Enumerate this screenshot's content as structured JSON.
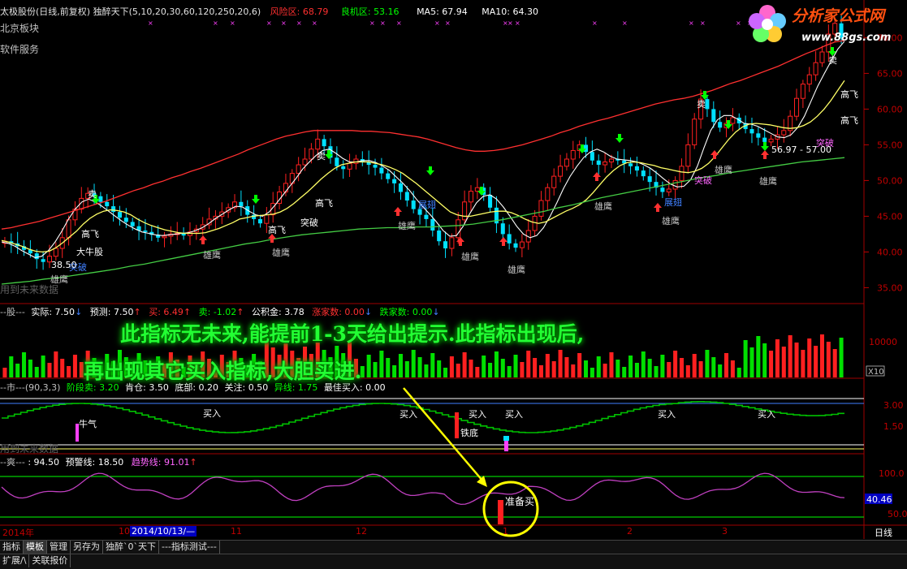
{
  "header": {
    "stock": "太极股份(日线,前复权)",
    "indicator": "独醉天下(5,10,20,30,60,120,250,20,6)",
    "risk_label": "风险区:",
    "risk_value": "68.79",
    "good_label": "良机区:",
    "good_value": "53.16",
    "ma5": "MA5: 67.94",
    "ma10": "MA10: 64.30",
    "line2": "北京板块",
    "line3": "软件服务",
    "nofuture": "用到未来数据",
    "colors": {
      "risk": "#ff3030",
      "good": "#00ff00",
      "text": "#e0e0e0",
      "ma5": "#ffffff",
      "ma10": "#ffffff"
    }
  },
  "logo": {
    "title": "分析家公式网",
    "url": "www.88gs.com"
  },
  "overlay": {
    "line1": "此指标无未来,能提前1-3天给出提示.此指标出现后,",
    "line2": "再出现其它买入指标,大胆买进."
  },
  "panel2": {
    "label": "--股---",
    "actual": "实际: 7.50",
    "predict": "预测: 7.50",
    "buy": "买: 6.49",
    "sell": "卖: -1.02",
    "fund": "公积金: 3.78",
    "up": "涨家数: 0.00",
    "down": "跌家数: 0.00",
    "x10": "X10"
  },
  "panel3": {
    "label": "--市---(90,3,3)",
    "stage_sell": "阶段卖: 3.20",
    "hold": "肯仓: 3.50",
    "bottom": "底部: 0.20",
    "focus": "关注: 0.50",
    "abnormal": "异线: 1.75",
    "best_buy": "最佳买入: 0.00",
    "nofuture": "用到未来数据"
  },
  "panel4": {
    "label": "--爽---",
    "v1": ": 94.50",
    "warn": "预警线: 18.50",
    "trend": "趋势线: 91.01",
    "current": "40.46",
    "annotation": "准备买"
  },
  "annotations": {
    "sell": "卖",
    "high_fly": "高飞",
    "break": "突破",
    "eagle": "雄鹰",
    "big_bull": "大牛股",
    "expand": "展翅",
    "buy": "买入",
    "bull": "牛气",
    "iron_bottom": "铁底",
    "low_price": "38.50",
    "range_label": "56.97 - 57.00",
    "buy_tiny": "买"
  },
  "xaxis": {
    "labels": [
      "2014年",
      "10",
      "11",
      "12",
      "1",
      "2",
      "3"
    ],
    "cursor": "2014/10/13/—",
    "right": "日线"
  },
  "tabs": [
    "指标",
    "模板",
    "管理",
    "另存为",
    "独醉`0`天下",
    "---指标测试---"
  ],
  "tabs2": [
    "扩展/\\",
    "关联报价"
  ],
  "chart_data": {
    "type": "line",
    "title": "太极股份(日线,前复权)",
    "price_axis": [
      70,
      65,
      60,
      55,
      50,
      45,
      40,
      35
    ],
    "ylim": [
      33,
      73
    ],
    "x_ticks": [
      "2014年",
      "10",
      "11",
      "12",
      "1",
      "2",
      "3"
    ],
    "price_close_approx": [
      41.5,
      41.2,
      40.8,
      40.3,
      39.8,
      39.0,
      38.6,
      39.4,
      40.5,
      42.0,
      44.5,
      46.0,
      47.5,
      48.2,
      47.8,
      47.0,
      46.4,
      45.6,
      44.8,
      44.2,
      43.6,
      43.0,
      42.8,
      42.4,
      42.0,
      42.2,
      42.5,
      42.6,
      42.3,
      42.8,
      43.2,
      43.8,
      44.6,
      45.0,
      45.6,
      46.2,
      47.0,
      46.4,
      45.2,
      44.6,
      44.0,
      45.2,
      46.8,
      48.4,
      49.6,
      51.0,
      52.2,
      53.0,
      54.4,
      55.8,
      54.8,
      53.2,
      52.0,
      51.6,
      52.4,
      53.0,
      52.6,
      52.2,
      51.8,
      51.0,
      50.2,
      49.6,
      48.4,
      47.2,
      46.0,
      45.2,
      44.6,
      43.0,
      41.5,
      40.5,
      42.0,
      44.5,
      47.0,
      48.5,
      49.0,
      48.0,
      46.2,
      44.0,
      42.5,
      41.2,
      40.6,
      41.4,
      43.0,
      45.0,
      47.2,
      49.0,
      50.6,
      52.0,
      53.0,
      54.2,
      55.0,
      54.0,
      52.8,
      52.2,
      52.6,
      53.0,
      52.8,
      52.4,
      52.0,
      51.4,
      50.6,
      49.8,
      49.0,
      48.4,
      48.8,
      50.0,
      52.0,
      55.0,
      58.6,
      61.4,
      60.0,
      58.2,
      57.4,
      58.0,
      58.8,
      58.0,
      57.2,
      56.6,
      56.0,
      55.4,
      55.8,
      56.4,
      57.0,
      59.0,
      61.5,
      63.5,
      64.8,
      66.5,
      68.0,
      70.5,
      72.0,
      70.0
    ],
    "series": [
      {
        "name": "MA5",
        "color": "#ffffff",
        "values": [
          41.4,
          41.2,
          40.8,
          40.2,
          39.7,
          39.2,
          39.4,
          40.2,
          41.4,
          42.9,
          44.6,
          46.0,
          47.0,
          47.4,
          47.0,
          46.4,
          45.7,
          45.0,
          44.3,
          43.7,
          43.2,
          42.8,
          42.6,
          42.4,
          42.3,
          42.4,
          42.5,
          42.6,
          42.7,
          43.0,
          43.4,
          44.0,
          44.7,
          45.3,
          45.9,
          46.4,
          46.3,
          45.7,
          45.2,
          45.0,
          45.6,
          46.7,
          47.9,
          49.1,
          50.3,
          51.6,
          52.6,
          53.5,
          54.2,
          54.4,
          53.8,
          53.1,
          52.6,
          52.6,
          52.8,
          52.8,
          52.5,
          52.0,
          51.4,
          50.5,
          49.6,
          48.6,
          47.4,
          46.3,
          45.3,
          44.2,
          43.0,
          42.2,
          42.3,
          43.6,
          45.4,
          46.9,
          47.8,
          48.0,
          47.4,
          46.3,
          45.0,
          43.6,
          42.5,
          42.0,
          42.3,
          43.4,
          45.0,
          46.9,
          48.9,
          50.6,
          52.0,
          53.2,
          54.0,
          54.4,
          54.0,
          53.4,
          53.0,
          52.9,
          52.8,
          52.6,
          52.2,
          51.7,
          51.0,
          50.2,
          49.5,
          49.1,
          49.2,
          50.1,
          52.0,
          54.6,
          57.0,
          58.5,
          59.1,
          59.1,
          58.6,
          58.0,
          57.9,
          57.6,
          57.1,
          56.6,
          56.1,
          56.0,
          56.4,
          57.4,
          59.0,
          61.1,
          63.2,
          65.0,
          66.7,
          68.4,
          69.5
        ]
      },
      {
        "name": "MA10",
        "color": "#ffff66",
        "values": [
          41.6,
          41.4,
          41.1,
          40.8,
          40.4,
          40.1,
          40.0,
          40.1,
          40.6,
          41.3,
          42.1,
          42.9,
          43.9,
          44.7,
          45.3,
          45.7,
          45.9,
          45.8,
          45.6,
          45.2,
          44.6,
          44.1,
          43.7,
          43.4,
          43.1,
          42.9,
          42.7,
          42.6,
          42.6,
          42.6,
          42.7,
          43.0,
          43.3,
          43.7,
          44.1,
          44.6,
          44.8,
          45.0,
          45.1,
          45.2,
          45.3,
          45.6,
          46.1,
          46.8,
          47.6,
          48.4,
          49.3,
          50.2,
          51.0,
          51.7,
          52.2,
          52.4,
          52.6,
          52.6,
          52.6,
          52.4,
          52.2,
          51.9,
          51.5,
          51.0,
          50.3,
          49.6,
          48.8,
          48.0,
          47.2,
          46.4,
          45.6,
          45.2,
          45.0,
          45.0,
          45.2,
          45.4,
          45.6,
          45.7,
          45.7,
          45.5,
          45.1,
          44.6,
          44.2,
          44.0,
          44.2,
          44.7,
          45.2,
          45.7,
          46.1,
          46.6,
          47.3,
          48.3,
          49.4,
          50.5,
          51.4,
          52.1,
          52.5,
          52.6,
          52.5,
          52.3,
          52.1,
          51.8,
          51.6,
          51.4,
          51.2,
          51.1,
          51.3,
          51.7,
          52.4,
          53.4,
          54.6,
          55.8,
          56.8,
          57.5,
          57.9,
          58.0,
          57.9,
          57.8,
          57.6,
          57.4,
          57.3,
          57.4,
          57.7,
          58.2,
          59.0,
          60.0,
          61.2,
          62.6,
          64.0
        ]
      },
      {
        "name": "MA20",
        "color": "#ff3030",
        "values": [
          43.2,
          43.4,
          43.7,
          44.0,
          44.3,
          44.7,
          45.1,
          45.5,
          45.9,
          46.3,
          46.7,
          47.1,
          47.6,
          48.1,
          48.6,
          49.0,
          49.5,
          49.9,
          50.4,
          50.8,
          51.3,
          51.7,
          52.2,
          52.7,
          53.2,
          53.7,
          54.3,
          54.8,
          55.3,
          55.8,
          56.2,
          56.5,
          56.8,
          57.0,
          57.0,
          57.0,
          57.0,
          57.0,
          56.9,
          56.9,
          56.8,
          56.7,
          56.5,
          56.3,
          56.1,
          55.8,
          55.4,
          55.0,
          54.6,
          54.3,
          54.1,
          54.1,
          54.2,
          54.4,
          54.7,
          55.0,
          55.4,
          55.8,
          56.2,
          56.7,
          57.1,
          57.6,
          58.0,
          58.4,
          58.7,
          59.1,
          59.5,
          59.9,
          60.3,
          60.7,
          61.0,
          61.3,
          61.5,
          61.8,
          62.2,
          62.6,
          63.1,
          63.6,
          64.0,
          64.5,
          65.0,
          65.5,
          66.0,
          66.6,
          67.2,
          67.8,
          68.3,
          68.9,
          69.4,
          69.6
        ]
      },
      {
        "name": "MA60",
        "color": "#44cc44",
        "values": [
          35.5,
          35.7,
          35.9,
          36.2,
          36.4,
          36.7,
          37.0,
          37.3,
          37.6,
          38.0,
          38.3,
          38.7,
          39.1,
          39.5,
          39.9,
          40.3,
          40.7,
          41.1,
          41.4,
          41.8,
          42.1,
          42.4,
          42.6,
          42.8,
          43.0,
          43.2,
          43.3,
          43.4,
          43.4,
          43.5,
          43.5,
          43.6,
          43.7,
          43.9,
          44.2,
          44.5,
          44.9,
          45.3,
          45.7,
          46.2,
          46.6,
          47.1,
          47.6,
          48.0,
          48.4,
          48.8,
          49.2,
          49.6,
          50.0,
          50.4,
          50.7,
          51.1,
          51.4,
          51.7,
          52.0,
          52.3,
          52.6,
          52.8,
          53.0,
          53.2
        ]
      }
    ],
    "indicator_axis": [
      "10000",
      "3.00",
      "1.50",
      "100.0",
      "50.0"
    ]
  }
}
